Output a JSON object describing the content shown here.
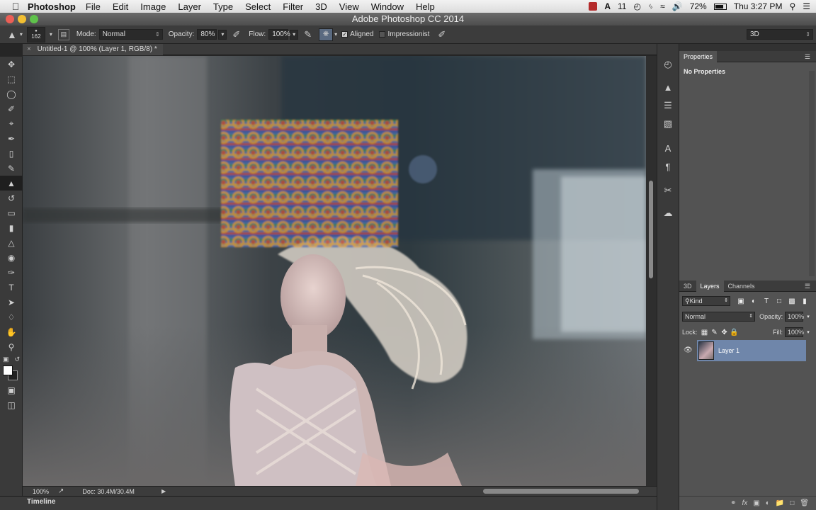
{
  "menubar": {
    "app_name": "Photoshop",
    "items": [
      "File",
      "Edit",
      "Image",
      "Layer",
      "Type",
      "Select",
      "Filter",
      "3D",
      "View",
      "Window",
      "Help"
    ],
    "adobe_count": "11",
    "battery": "72%",
    "clock": "Thu 3:27 PM"
  },
  "window": {
    "title": "Adobe Photoshop CC 2014"
  },
  "options_bar": {
    "brush_size": "162",
    "mode_label": "Mode:",
    "mode_value": "Normal",
    "opacity_label": "Opacity:",
    "opacity_value": "80%",
    "flow_label": "Flow:",
    "flow_value": "100%",
    "aligned_label": "Aligned",
    "aligned_checked": true,
    "impressionist_label": "Impressionist",
    "impressionist_checked": false,
    "workspace": "3D"
  },
  "document": {
    "tab_title": "Untitled-1 @ 100% (Layer 1, RGB/8) *",
    "zoom": "100%",
    "doc_size": "Doc: 30.4M/30.4M"
  },
  "timeline": {
    "label": "Timeline"
  },
  "properties_panel": {
    "title": "Properties",
    "message": "No Properties"
  },
  "layers_panel": {
    "tabs": [
      "3D",
      "Layers",
      "Channels"
    ],
    "active_tab": "Layers",
    "filter_kind": "Kind",
    "blend_mode": "Normal",
    "opacity_label": "Opacity:",
    "opacity_value": "100%",
    "lock_label": "Lock:",
    "fill_label": "Fill:",
    "fill_value": "100%",
    "layers": [
      {
        "name": "Layer 1",
        "visible": true,
        "selected": true
      }
    ]
  },
  "colors": {
    "selected_layer": "#6f86aa",
    "panel_bg": "#535353",
    "app_bg": "#3a3a3a"
  }
}
